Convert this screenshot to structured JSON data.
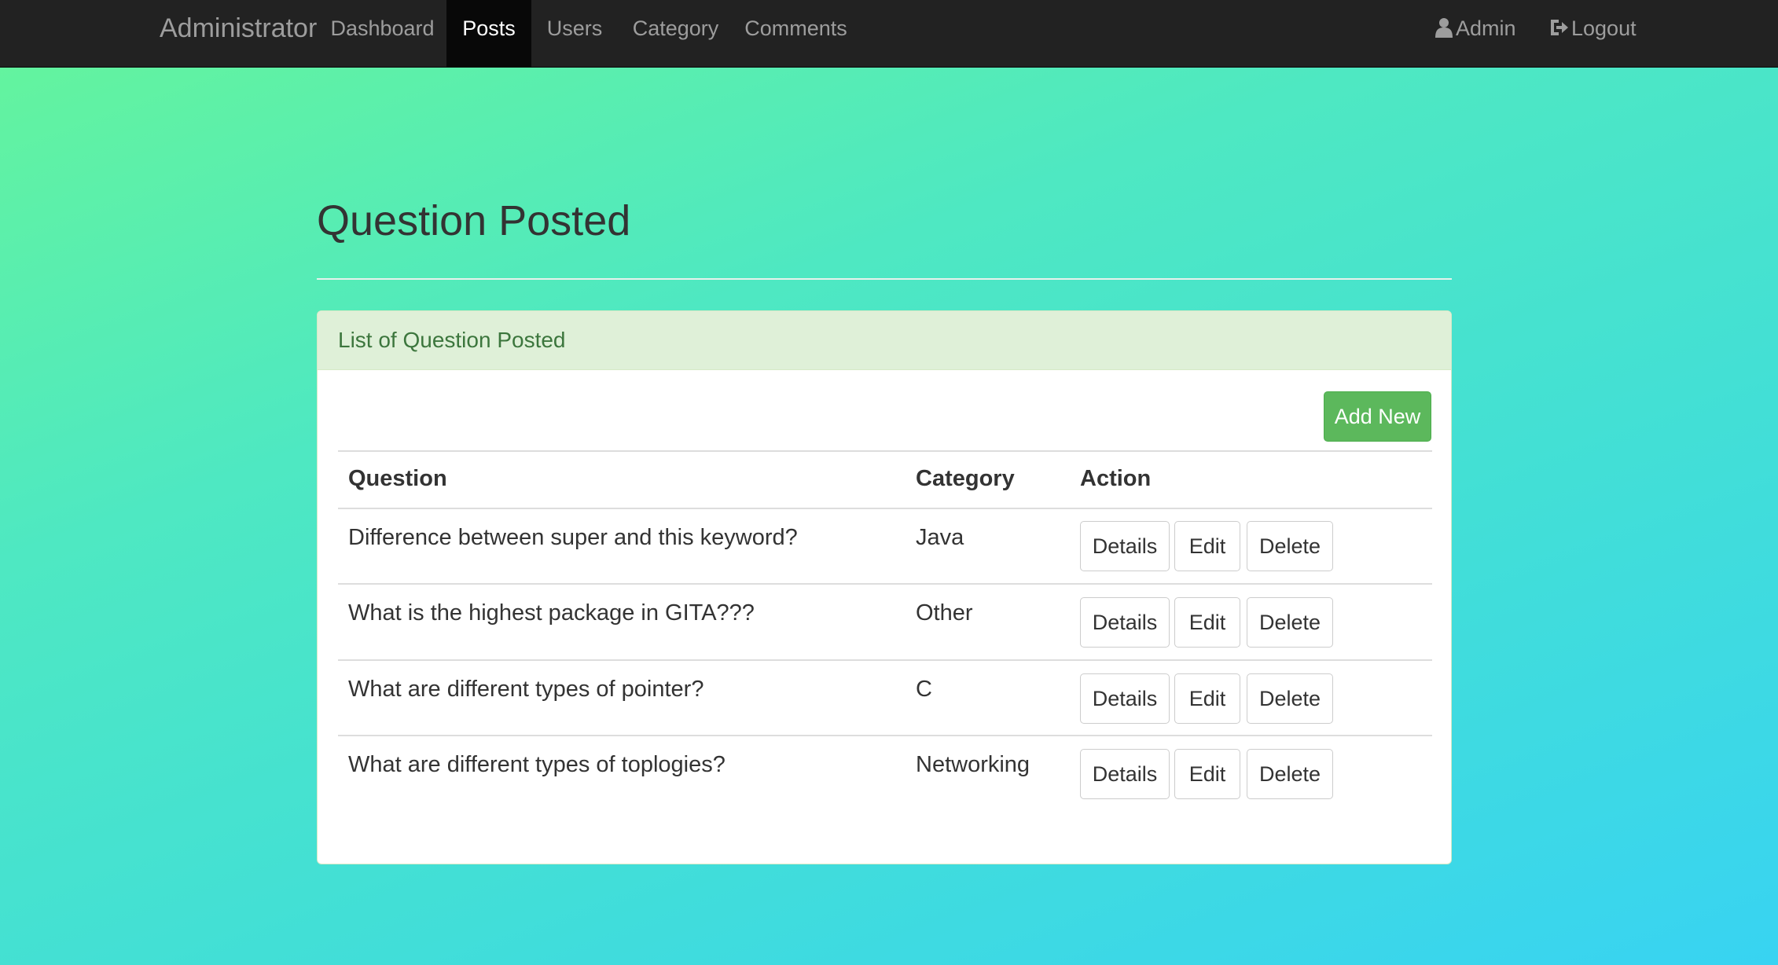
{
  "navbar": {
    "brand": "Administrator",
    "items": [
      {
        "label": "Dashboard",
        "active": false
      },
      {
        "label": "Posts",
        "active": true
      },
      {
        "label": "Users",
        "active": false
      },
      {
        "label": "Category",
        "active": false
      },
      {
        "label": "Comments",
        "active": false
      }
    ],
    "user_label": "Admin",
    "logout_label": "Logout"
  },
  "page": {
    "title": "Question Posted"
  },
  "panel": {
    "heading": "List of Question Posted",
    "add_label": "Add New"
  },
  "table": {
    "headers": {
      "question": "Question",
      "category": "Category",
      "action": "Action"
    },
    "rows": [
      {
        "question": "Difference between super and this keyword?",
        "category": "Java"
      },
      {
        "question": "What is the highest package in GITA???",
        "category": "Other"
      },
      {
        "question": "What are different types of pointer?",
        "category": "C"
      },
      {
        "question": "What are different types of toplogies?",
        "category": "Networking"
      }
    ],
    "actions": {
      "details": "Details",
      "edit": "Edit",
      "delete": "Delete"
    }
  },
  "colors": {
    "navbar": "#222222",
    "active_tab": "#080808",
    "panel_heading_bg": "#dff0d8",
    "panel_heading_text": "#3c763d",
    "success_button": "#5cb85c"
  },
  "icons": {
    "user": "user-icon",
    "logout": "logout-icon"
  }
}
